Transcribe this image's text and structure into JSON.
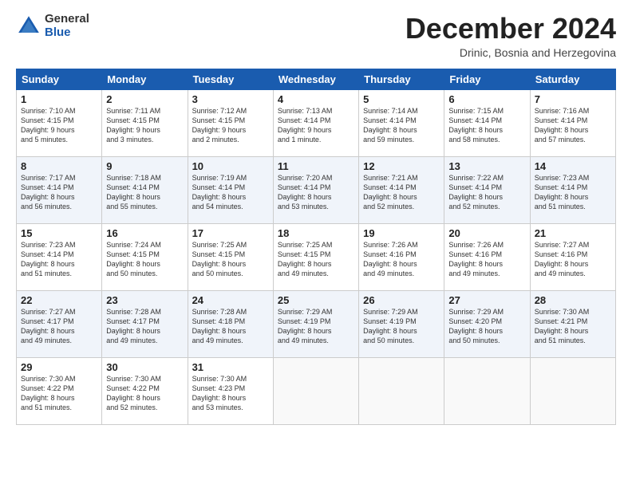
{
  "header": {
    "logo_general": "General",
    "logo_blue": "Blue",
    "month_title": "December 2024",
    "subtitle": "Drinic, Bosnia and Herzegovina"
  },
  "days_of_week": [
    "Sunday",
    "Monday",
    "Tuesday",
    "Wednesday",
    "Thursday",
    "Friday",
    "Saturday"
  ],
  "weeks": [
    [
      {
        "day": 1,
        "lines": [
          "Sunrise: 7:10 AM",
          "Sunset: 4:15 PM",
          "Daylight: 9 hours",
          "and 5 minutes."
        ]
      },
      {
        "day": 2,
        "lines": [
          "Sunrise: 7:11 AM",
          "Sunset: 4:15 PM",
          "Daylight: 9 hours",
          "and 3 minutes."
        ]
      },
      {
        "day": 3,
        "lines": [
          "Sunrise: 7:12 AM",
          "Sunset: 4:15 PM",
          "Daylight: 9 hours",
          "and 2 minutes."
        ]
      },
      {
        "day": 4,
        "lines": [
          "Sunrise: 7:13 AM",
          "Sunset: 4:14 PM",
          "Daylight: 9 hours",
          "and 1 minute."
        ]
      },
      {
        "day": 5,
        "lines": [
          "Sunrise: 7:14 AM",
          "Sunset: 4:14 PM",
          "Daylight: 8 hours",
          "and 59 minutes."
        ]
      },
      {
        "day": 6,
        "lines": [
          "Sunrise: 7:15 AM",
          "Sunset: 4:14 PM",
          "Daylight: 8 hours",
          "and 58 minutes."
        ]
      },
      {
        "day": 7,
        "lines": [
          "Sunrise: 7:16 AM",
          "Sunset: 4:14 PM",
          "Daylight: 8 hours",
          "and 57 minutes."
        ]
      }
    ],
    [
      {
        "day": 8,
        "lines": [
          "Sunrise: 7:17 AM",
          "Sunset: 4:14 PM",
          "Daylight: 8 hours",
          "and 56 minutes."
        ]
      },
      {
        "day": 9,
        "lines": [
          "Sunrise: 7:18 AM",
          "Sunset: 4:14 PM",
          "Daylight: 8 hours",
          "and 55 minutes."
        ]
      },
      {
        "day": 10,
        "lines": [
          "Sunrise: 7:19 AM",
          "Sunset: 4:14 PM",
          "Daylight: 8 hours",
          "and 54 minutes."
        ]
      },
      {
        "day": 11,
        "lines": [
          "Sunrise: 7:20 AM",
          "Sunset: 4:14 PM",
          "Daylight: 8 hours",
          "and 53 minutes."
        ]
      },
      {
        "day": 12,
        "lines": [
          "Sunrise: 7:21 AM",
          "Sunset: 4:14 PM",
          "Daylight: 8 hours",
          "and 52 minutes."
        ]
      },
      {
        "day": 13,
        "lines": [
          "Sunrise: 7:22 AM",
          "Sunset: 4:14 PM",
          "Daylight: 8 hours",
          "and 52 minutes."
        ]
      },
      {
        "day": 14,
        "lines": [
          "Sunrise: 7:23 AM",
          "Sunset: 4:14 PM",
          "Daylight: 8 hours",
          "and 51 minutes."
        ]
      }
    ],
    [
      {
        "day": 15,
        "lines": [
          "Sunrise: 7:23 AM",
          "Sunset: 4:14 PM",
          "Daylight: 8 hours",
          "and 51 minutes."
        ]
      },
      {
        "day": 16,
        "lines": [
          "Sunrise: 7:24 AM",
          "Sunset: 4:15 PM",
          "Daylight: 8 hours",
          "and 50 minutes."
        ]
      },
      {
        "day": 17,
        "lines": [
          "Sunrise: 7:25 AM",
          "Sunset: 4:15 PM",
          "Daylight: 8 hours",
          "and 50 minutes."
        ]
      },
      {
        "day": 18,
        "lines": [
          "Sunrise: 7:25 AM",
          "Sunset: 4:15 PM",
          "Daylight: 8 hours",
          "and 49 minutes."
        ]
      },
      {
        "day": 19,
        "lines": [
          "Sunrise: 7:26 AM",
          "Sunset: 4:16 PM",
          "Daylight: 8 hours",
          "and 49 minutes."
        ]
      },
      {
        "day": 20,
        "lines": [
          "Sunrise: 7:26 AM",
          "Sunset: 4:16 PM",
          "Daylight: 8 hours",
          "and 49 minutes."
        ]
      },
      {
        "day": 21,
        "lines": [
          "Sunrise: 7:27 AM",
          "Sunset: 4:16 PM",
          "Daylight: 8 hours",
          "and 49 minutes."
        ]
      }
    ],
    [
      {
        "day": 22,
        "lines": [
          "Sunrise: 7:27 AM",
          "Sunset: 4:17 PM",
          "Daylight: 8 hours",
          "and 49 minutes."
        ]
      },
      {
        "day": 23,
        "lines": [
          "Sunrise: 7:28 AM",
          "Sunset: 4:17 PM",
          "Daylight: 8 hours",
          "and 49 minutes."
        ]
      },
      {
        "day": 24,
        "lines": [
          "Sunrise: 7:28 AM",
          "Sunset: 4:18 PM",
          "Daylight: 8 hours",
          "and 49 minutes."
        ]
      },
      {
        "day": 25,
        "lines": [
          "Sunrise: 7:29 AM",
          "Sunset: 4:19 PM",
          "Daylight: 8 hours",
          "and 49 minutes."
        ]
      },
      {
        "day": 26,
        "lines": [
          "Sunrise: 7:29 AM",
          "Sunset: 4:19 PM",
          "Daylight: 8 hours",
          "and 50 minutes."
        ]
      },
      {
        "day": 27,
        "lines": [
          "Sunrise: 7:29 AM",
          "Sunset: 4:20 PM",
          "Daylight: 8 hours",
          "and 50 minutes."
        ]
      },
      {
        "day": 28,
        "lines": [
          "Sunrise: 7:30 AM",
          "Sunset: 4:21 PM",
          "Daylight: 8 hours",
          "and 51 minutes."
        ]
      }
    ],
    [
      {
        "day": 29,
        "lines": [
          "Sunrise: 7:30 AM",
          "Sunset: 4:22 PM",
          "Daylight: 8 hours",
          "and 51 minutes."
        ]
      },
      {
        "day": 30,
        "lines": [
          "Sunrise: 7:30 AM",
          "Sunset: 4:22 PM",
          "Daylight: 8 hours",
          "and 52 minutes."
        ]
      },
      {
        "day": 31,
        "lines": [
          "Sunrise: 7:30 AM",
          "Sunset: 4:23 PM",
          "Daylight: 8 hours",
          "and 53 minutes."
        ]
      },
      null,
      null,
      null,
      null
    ]
  ]
}
